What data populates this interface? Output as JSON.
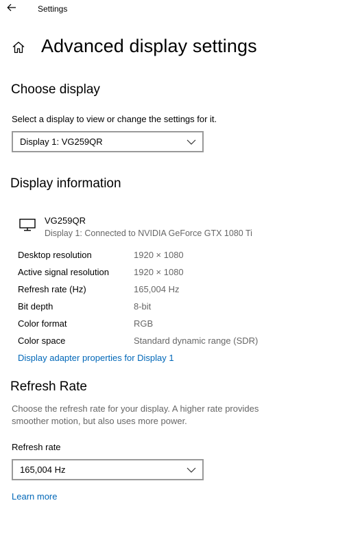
{
  "window": {
    "app_title": "Settings"
  },
  "page": {
    "title": "Advanced display settings"
  },
  "choose_display": {
    "title": "Choose display",
    "description": "Select a display to view or change the settings for it.",
    "selected_display": "Display 1: VG259QR"
  },
  "display_information": {
    "title": "Display information",
    "monitor_name": "VG259QR",
    "monitor_subtitle": "Display 1: Connected to NVIDIA GeForce GTX 1080 Ti",
    "rows": [
      {
        "label": "Desktop resolution",
        "value": "1920 × 1080"
      },
      {
        "label": "Active signal resolution",
        "value": "1920 × 1080"
      },
      {
        "label": "Refresh rate (Hz)",
        "value": "165,004 Hz"
      },
      {
        "label": "Bit depth",
        "value": "8-bit"
      },
      {
        "label": "Color format",
        "value": "RGB"
      },
      {
        "label": "Color space",
        "value": "Standard dynamic range (SDR)"
      }
    ],
    "adapter_link": "Display adapter properties for Display 1"
  },
  "refresh_rate": {
    "title": "Refresh Rate",
    "description": "Choose the refresh rate for your display. A higher rate provides smoother motion, but also uses more power.",
    "field_label": "Refresh rate",
    "selected_rate": "165,004 Hz",
    "learn_more": "Learn more"
  },
  "colors": {
    "link": "#0067b8",
    "secondary_text": "#666666",
    "dropdown_border": "#999999"
  },
  "icons": {
    "back": "back-arrow-icon",
    "home": "home-icon",
    "monitor": "monitor-icon",
    "chevron": "chevron-down-icon"
  }
}
